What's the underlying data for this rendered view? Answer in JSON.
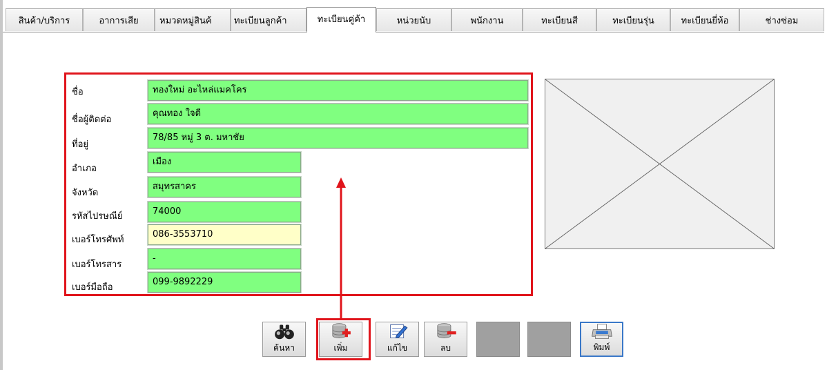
{
  "tabs": [
    {
      "label": "สินค้า/บริการ",
      "active": false
    },
    {
      "label": "อาการเสีย",
      "active": false
    },
    {
      "label": "หมวดหมู่สินค้",
      "active": false
    },
    {
      "label": "ทะเบียนลูกค้า",
      "active": false
    },
    {
      "label": "ทะเบียนคู่ค้า",
      "active": true
    },
    {
      "label": "หน่วยนับ",
      "active": false
    },
    {
      "label": "พนักงาน",
      "active": false
    },
    {
      "label": "ทะเบียนสี",
      "active": false
    },
    {
      "label": "ทะเบียนรุ่น",
      "active": false
    },
    {
      "label": "ทะเบียนยี่ห้อ",
      "active": false
    },
    {
      "label": "ช่างซ่อม",
      "active": false
    }
  ],
  "form": {
    "name": {
      "label": "ชื่อ",
      "value": "ทองใหม่ อะไหล่แมคโคร"
    },
    "contact": {
      "label": "ชื่อผู้ติดต่อ",
      "value": "คุณทอง ใจดี"
    },
    "address": {
      "label": "ที่อยู่",
      "value": "78/85  หมู่ 3 ต. มหาชัย"
    },
    "district": {
      "label": "อำเภอ",
      "value": "เมือง"
    },
    "province": {
      "label": "จังหวัด",
      "value": "สมุทรสาคร"
    },
    "postcode": {
      "label": "รหัสไปรษณีย์",
      "value": "74000"
    },
    "phone": {
      "label": "เบอร์โทรศัพท์",
      "value": "086-3553710"
    },
    "fax": {
      "label": "เบอร์โทรสาร",
      "value": "-"
    },
    "mobile": {
      "label": "เบอร์มือถือ",
      "value": "099-9892229"
    }
  },
  "toolbar": {
    "search_label": "ค้นหา",
    "add_label": "เพิ่ม",
    "edit_label": "แก้ไข",
    "delete_label": "ลบ",
    "print_label": "พิมพ์"
  },
  "icons": {
    "search": "binoculars-icon",
    "add": "database-add-icon",
    "edit": "edit-note-icon",
    "delete": "database-remove-icon",
    "print": "printer-icon"
  },
  "colors": {
    "field_green": "#80ff80",
    "field_focus_yellow": "#ffffc8",
    "annotation_red": "#e0141b",
    "selected_blue": "#3a78c8"
  }
}
